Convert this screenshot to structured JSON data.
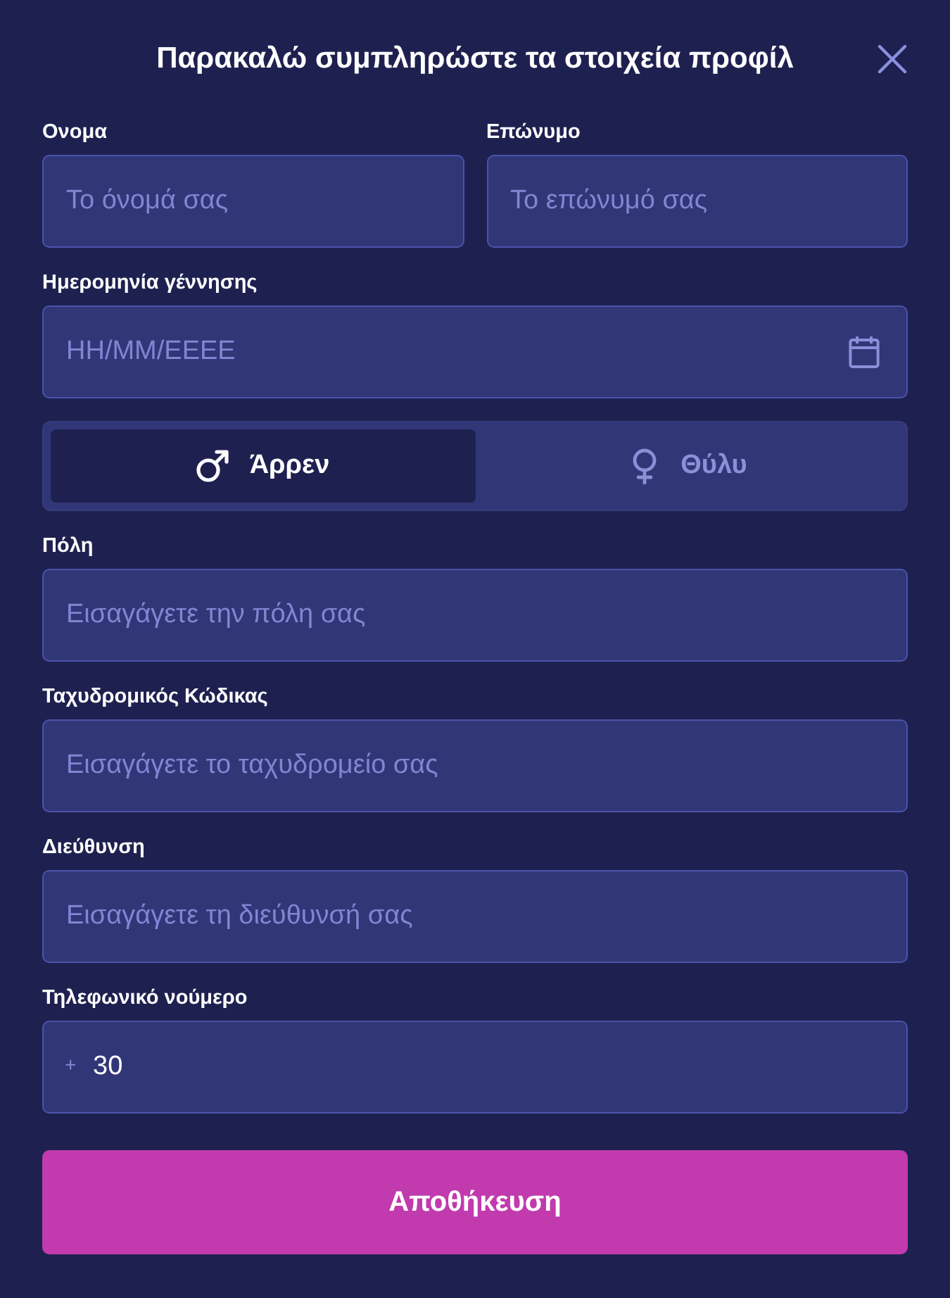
{
  "dialog": {
    "title": "Παρακαλώ συμπληρώστε τα στοιχεία προφίλ"
  },
  "name_row": [
    {
      "label": "Ονομα",
      "placeholder": "Το όνομά σας"
    },
    {
      "label": "Επώνυμο",
      "placeholder": "Το επώνυμό σας"
    }
  ],
  "birth_date": {
    "label": "Ημερομηνία γέννησης",
    "placeholder": "ΗΗ/ΜΜ/ΕΕΕΕ"
  },
  "gender": [
    {
      "kind": "male",
      "label": "Άρρεν",
      "selected": true
    },
    {
      "kind": "female",
      "label": "Θύλυ",
      "selected": false
    }
  ],
  "fields": [
    {
      "label": "Πόλη",
      "placeholder": "Εισαγάγετε την πόλη σας"
    },
    {
      "label": "Ταχυδρομικός Κώδικας",
      "placeholder": "Εισαγάγετε το ταχυδρομείο σας"
    },
    {
      "label": "Διεύθυνση",
      "placeholder": "Εισαγάγετε τη διεύθυνσή σας"
    }
  ],
  "phone": {
    "label": "Τηλεφωνικό νούμερο",
    "prefix": "+",
    "value": "30"
  },
  "save_button": "Αποθήκευση"
}
